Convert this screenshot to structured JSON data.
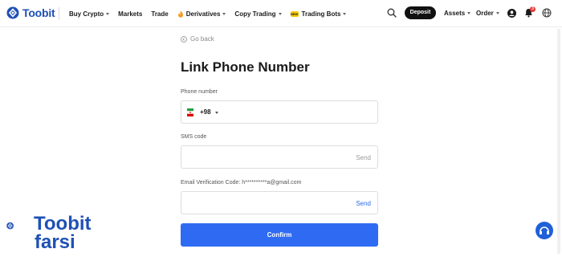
{
  "brand": {
    "name": "Toobit",
    "color": "#1f50b5"
  },
  "nav": {
    "items": [
      {
        "label": "Buy Crypto",
        "caret": true
      },
      {
        "label": "Markets",
        "caret": false
      },
      {
        "label": "Trade",
        "caret": false
      },
      {
        "label": "Derivatives",
        "caret": true,
        "icon": "fire-icon"
      },
      {
        "label": "Copy Trading",
        "caret": true
      },
      {
        "label": "Trading Bots",
        "caret": true,
        "badge": "NEW"
      }
    ],
    "deposit_label": "Deposit",
    "assets_label": "Assets",
    "order_label": "Order",
    "notification_count": "3"
  },
  "form": {
    "back_label": "Go back",
    "title": "Link Phone Number",
    "phone_label": "Phone number",
    "country_code": "+98",
    "phone_value": "",
    "sms_label": "SMS code",
    "sms_value": "",
    "sms_send": "Send",
    "email_label": "Email Verification Code: h**********a@gmail.com",
    "email_value": "",
    "email_send": "Send",
    "confirm_label": "Confirm"
  },
  "watermark": {
    "line1": "Toobit",
    "line2": "farsi"
  },
  "colors": {
    "primary": "#2f6bf2",
    "send_active": "#2b6be6",
    "notification": "#e53935"
  }
}
